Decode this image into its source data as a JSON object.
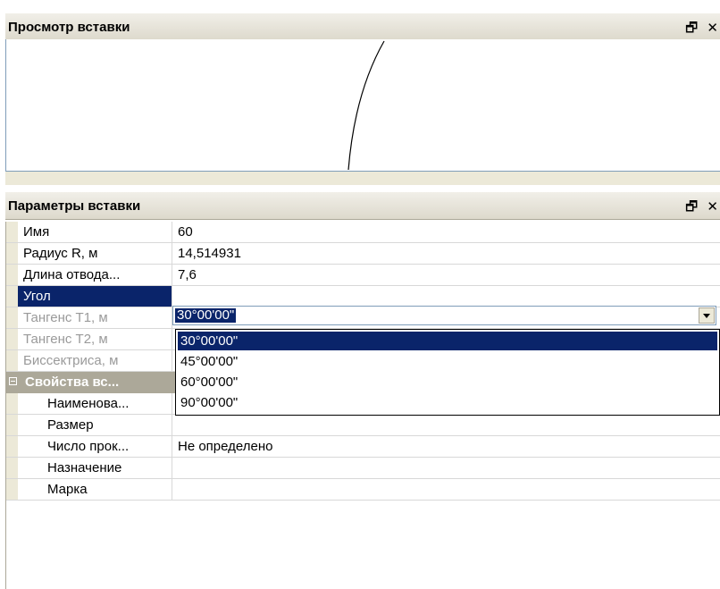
{
  "preview_panel": {
    "title": "Просмотр вставки",
    "float_icon": "🗗",
    "close_icon": "✕"
  },
  "params_panel": {
    "title": "Параметры вставки",
    "float_icon": "🗗",
    "close_icon": "✕"
  },
  "rows": {
    "name": {
      "label": "Имя",
      "value": "60"
    },
    "radius": {
      "label": "Радиус R, м",
      "value": "14,514931"
    },
    "length": {
      "label": "Длина отвода...",
      "value": "7,6"
    },
    "angle": {
      "label": "Угол",
      "value": "30°00'00\""
    },
    "tangent1": {
      "label": "Тангенс Т1, м"
    },
    "tangent2": {
      "label": "Тангенс Т2, м"
    },
    "bisector": {
      "label": "Биссектриса, м"
    }
  },
  "category": {
    "label": "Свойства вс..."
  },
  "sub_rows": {
    "naming": {
      "label": "Наименова...",
      "value": ""
    },
    "size": {
      "label": "Размер",
      "value": ""
    },
    "count": {
      "label": "Число прок...",
      "value": "Не определено"
    },
    "purpose": {
      "label": "Назначение",
      "value": ""
    },
    "mark": {
      "label": "Марка",
      "value": ""
    }
  },
  "angle_options": [
    "30°00'00\"",
    "45°00'00\"",
    "60°00'00\"",
    "90°00'00\""
  ]
}
